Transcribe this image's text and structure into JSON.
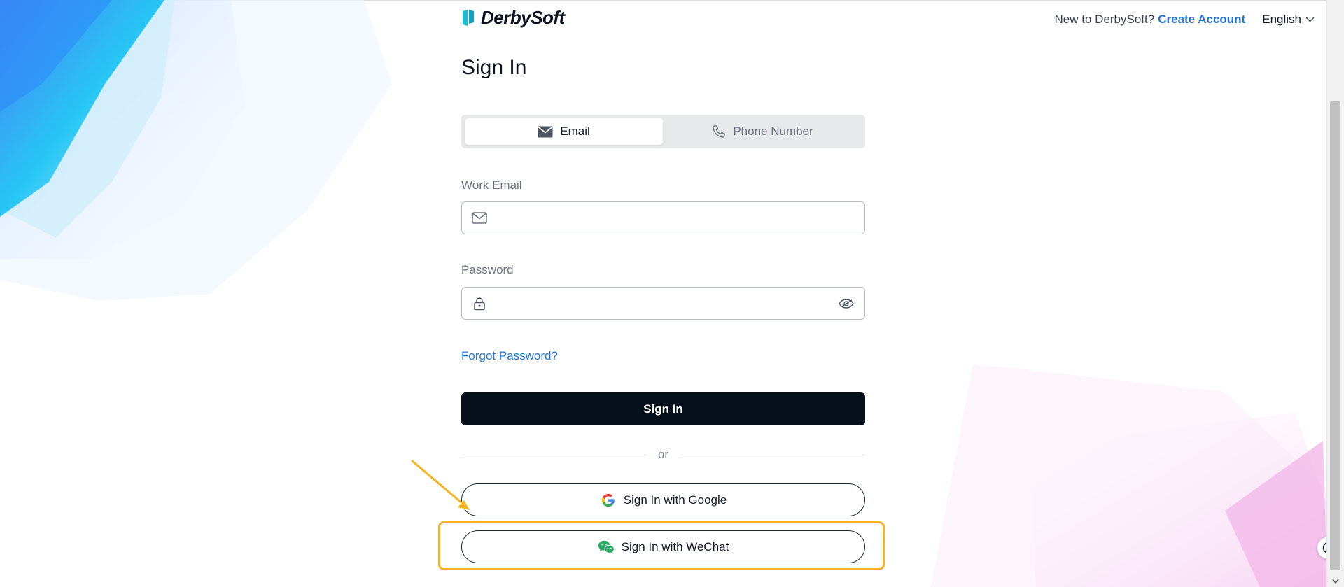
{
  "header": {
    "brand": "DerbySoft",
    "new_to_text": "New to DerbySoft?",
    "create_account": "Create Account",
    "language": "English"
  },
  "form": {
    "title": "Sign In",
    "tabs": [
      {
        "label": "Email",
        "active": true,
        "icon": "envelope-icon"
      },
      {
        "label": "Phone Number",
        "active": false,
        "icon": "phone-icon"
      }
    ],
    "email": {
      "label": "Work Email",
      "value": "",
      "placeholder": ""
    },
    "password": {
      "label": "Password",
      "value": "",
      "placeholder": ""
    },
    "forgot_password": "Forgot Password?",
    "sign_in": "Sign In",
    "divider": "or",
    "google": "Sign In with Google",
    "wechat": "Sign In with WeChat"
  },
  "colors": {
    "link": "#1f73d8",
    "primary_button": "#07111b",
    "highlight": "#f5b324",
    "wechat_green": "#2aae67"
  }
}
